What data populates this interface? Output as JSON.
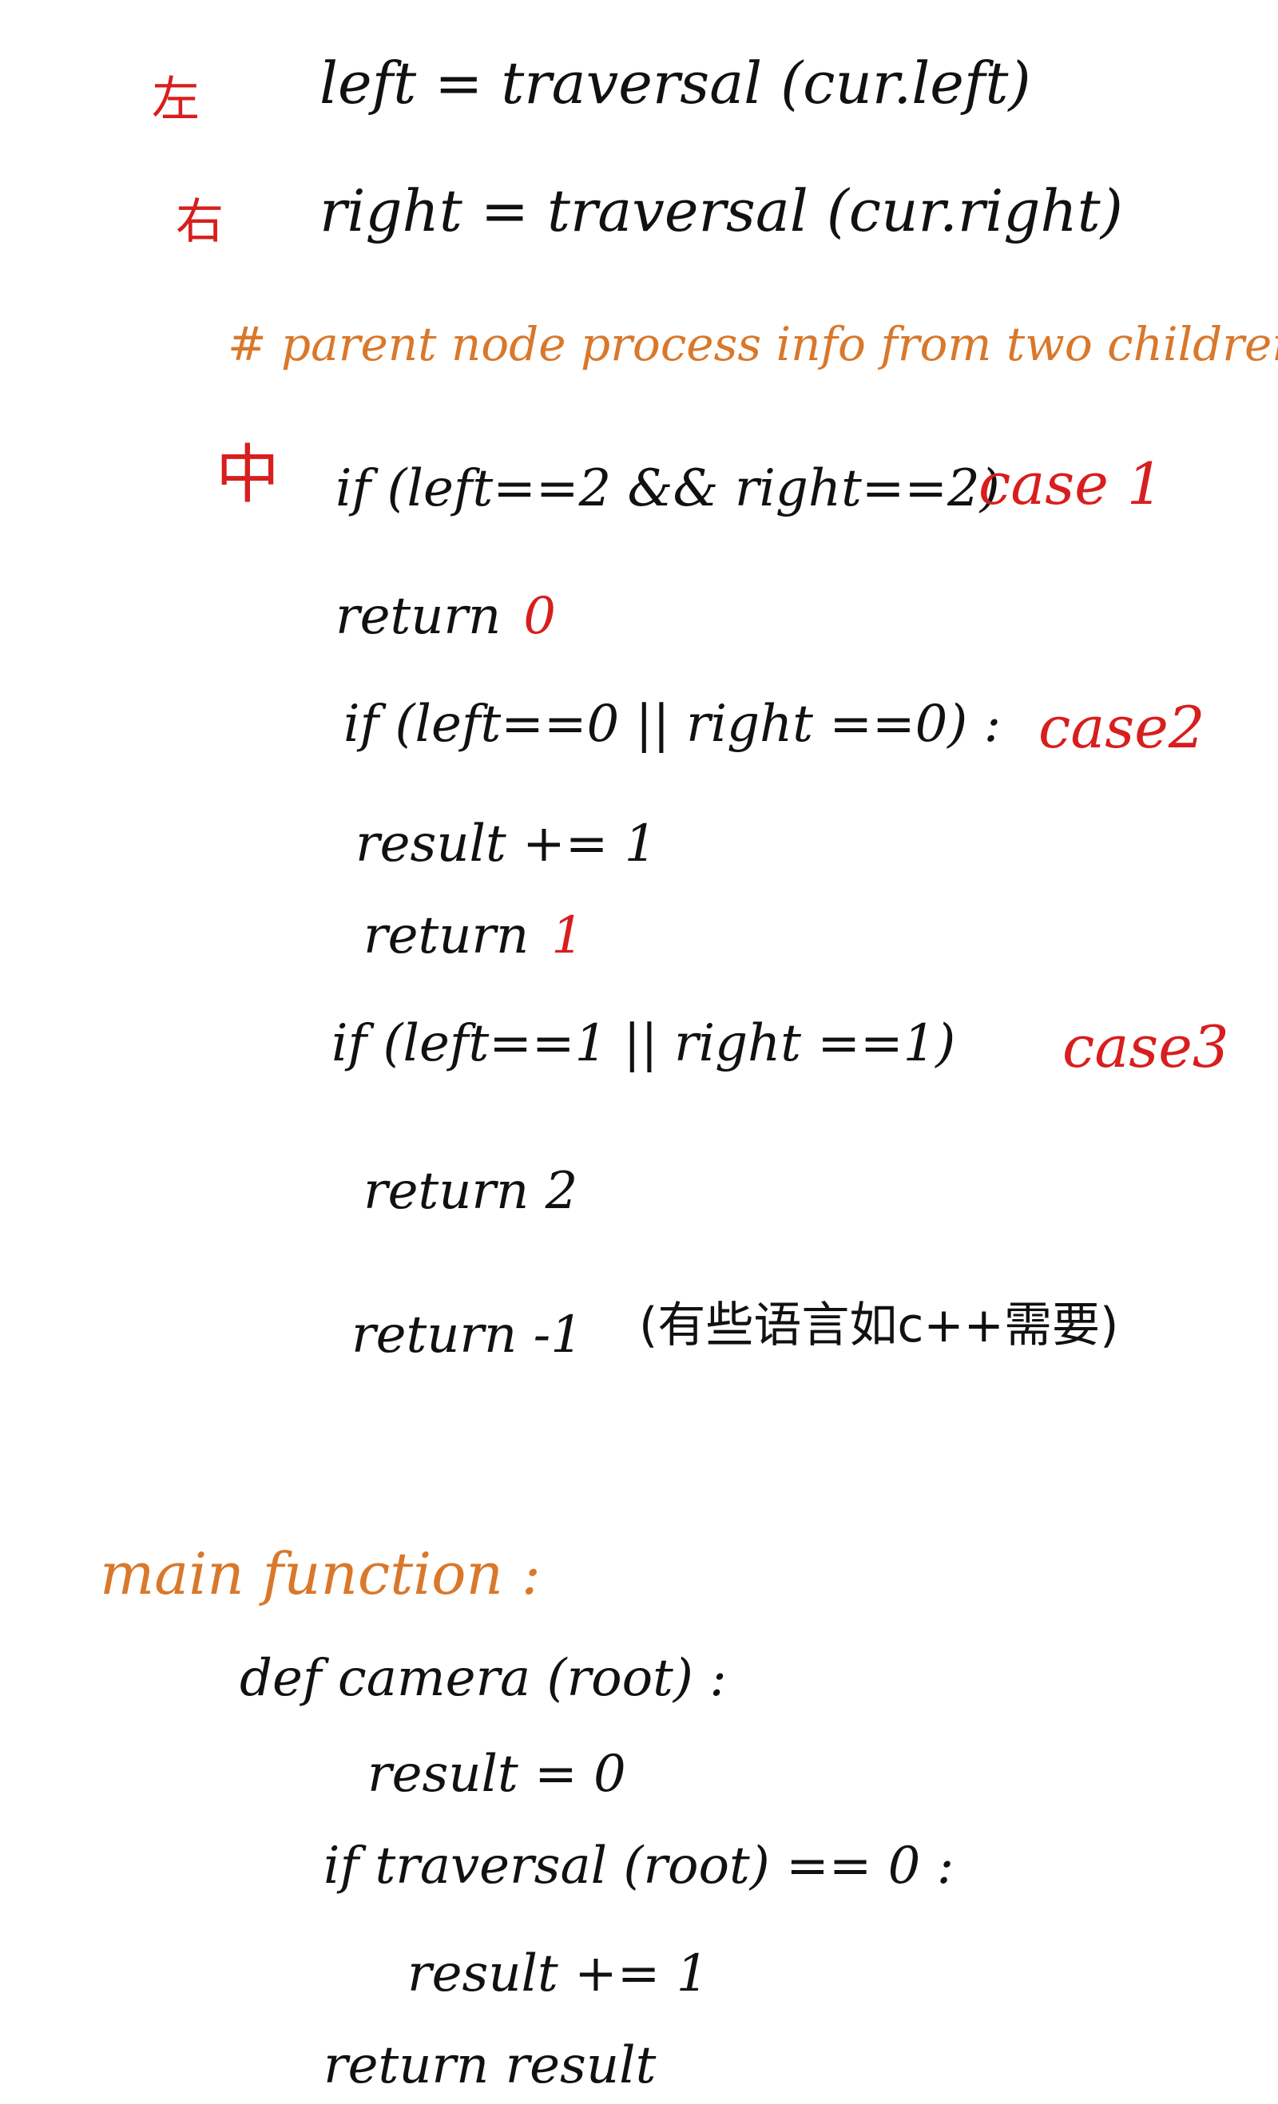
{
  "margin_marks": {
    "left_mark": "左",
    "right_mark": "右",
    "middle_mark": "中"
  },
  "traversal_calls": {
    "left_line": "left = traversal (cur.left)",
    "right_line": "right = traversal (cur.right)"
  },
  "comment": {
    "text": "# parent node process info from two children ."
  },
  "case1": {
    "condition": "if (left==2 && right==2)",
    "label": "case 1",
    "return_word": "return",
    "return_value": "0"
  },
  "case2": {
    "condition": "if (left==0 || right ==0) :",
    "label": "case2",
    "result_line": "result += 1",
    "return_word": "return",
    "return_value": "1"
  },
  "case3": {
    "condition": "if  (left==1 || right ==1)",
    "label": "case3",
    "return_line": "return 2"
  },
  "fallback": {
    "return_line": "return -1",
    "note": "(有些语言如c++需要)"
  },
  "main_function": {
    "heading": "main function :",
    "def_line": "def camera (root) :",
    "init_line": "result = 0",
    "if_line": "if traversal (root) == 0 :",
    "increment_line": "result += 1",
    "return_line": "return result"
  },
  "colors": {
    "ink": "#111111",
    "red": "#d81e1e",
    "orange": "#d9782b",
    "background": "#ffffff"
  }
}
